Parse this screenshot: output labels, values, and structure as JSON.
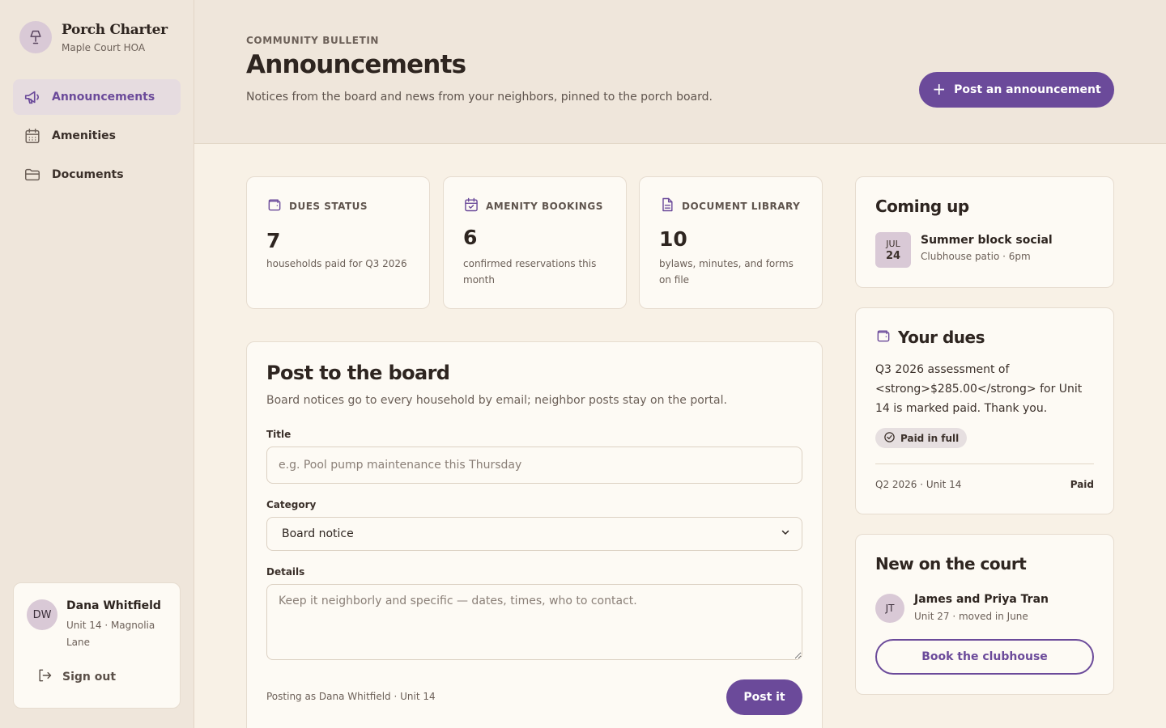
{
  "brand": {
    "name": "Porch Charter",
    "subtitle": "Maple Court HOA",
    "icon": "lamp-icon"
  },
  "nav": [
    {
      "label": "Announcements",
      "icon": "megaphone-icon",
      "active": true
    },
    {
      "label": "Amenities",
      "icon": "calendar-icon",
      "active": false
    },
    {
      "label": "Documents",
      "icon": "folder-icon",
      "active": false
    }
  ],
  "user": {
    "initials": "DW",
    "name": "Dana Whitfield",
    "unit": "Unit 14 · Magnolia Lane",
    "signout_label": "Sign out"
  },
  "header": {
    "eyebrow": "COMMUNITY BULLETIN",
    "title": "Announcements",
    "description": "Notices from the board and news from your neighbors, pinned to the porch board.",
    "post_button_label": "Post an announcement"
  },
  "stats": [
    {
      "label": "DUES STATUS",
      "value": "7",
      "description": "households paid for Q3 2026",
      "icon": "wallet-icon"
    },
    {
      "label": "AMENITY BOOKINGS",
      "value": "6",
      "description": "confirmed reservations this month",
      "icon": "calendar-check-icon"
    },
    {
      "label": "DOCUMENT LIBRARY",
      "value": "10",
      "description": "bylaws, minutes, and forms on file",
      "icon": "document-icon"
    }
  ],
  "form": {
    "title": "Post to the board",
    "subtitle": "Board notices go to every household by email; neighbor posts stay on the portal.",
    "title_label": "Title",
    "title_placeholder": "e.g. Pool pump maintenance this Thursday",
    "title_value": "",
    "category_label": "Category",
    "category_value": "Board notice",
    "details_label": "Details",
    "details_placeholder": "Keep it neighborly and specific — dates, times, who to contact.",
    "details_value": "",
    "posting_as": "Posting as Dana Whitfield · Unit 14",
    "submit_label": "Post it"
  },
  "coming_up": {
    "title": "Coming up",
    "event": {
      "month": "JUL",
      "day": "24",
      "title": "Summer block social",
      "subtitle": "Clubhouse patio · 6pm"
    }
  },
  "dues": {
    "title": "Your dues",
    "text": "Q3 2026 assessment of <strong>$285.00</strong> for Unit 14 is marked paid. Thank you.",
    "badge": "Paid in full",
    "row_label": "Q2 2026 · Unit 14",
    "row_status": "Paid"
  },
  "neighbors": {
    "title": "New on the court",
    "initials": "JT",
    "name": "James and Priya Tran",
    "subtitle": "Unit 27 · moved in June",
    "book_label": "Book the clubhouse"
  },
  "colors": {
    "accent": "#6b4a9a",
    "sidebar_bg": "#efe6db",
    "page_bg": "#f8f1e6",
    "card_bg": "#fdfaf4"
  }
}
